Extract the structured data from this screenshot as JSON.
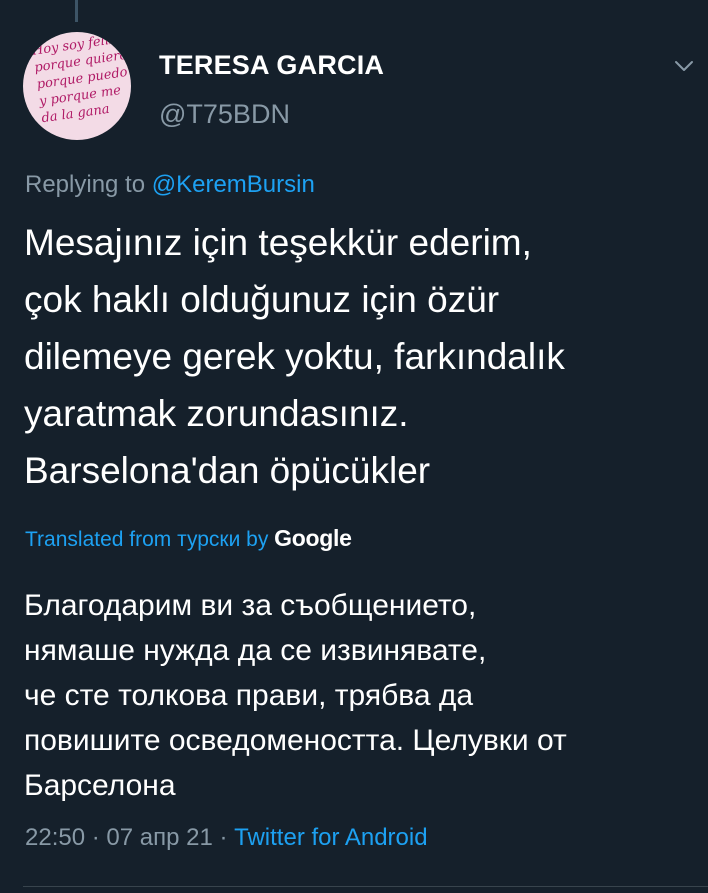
{
  "avatar": {
    "text": "Hoy soy feliz\nporque quiero,\nporque puedo\ny porque me\nda la gana"
  },
  "author": {
    "name": "TERESA GARCIA",
    "handle": "@T75BDN"
  },
  "reply": {
    "prefix": "Replying to ",
    "mention": "@KeremBursin"
  },
  "tweet": {
    "text": "Mesajınız için teşekkür ederim,\nçok haklı olduğunuz için özür\ndilemeye gerek yoktu, farkındalık\nyaratmak zorundasınız.\nBarselona'dan öpücükler"
  },
  "translation": {
    "label": "Translated from турски by ",
    "provider": "Google",
    "text": "Благодарим ви за съобщението,\nнямаше нужда да се извинявате,\nче сте толкова прави, трябва да\nповишите осведомеността. Целувки от\nБарселона"
  },
  "meta": {
    "time": "22:50",
    "separator1": " · ",
    "date": "07 апр 21",
    "separator2": " · ",
    "source": "Twitter for Android"
  },
  "icons": {
    "menu": "chevron-down-icon"
  },
  "colors": {
    "background": "#15202b",
    "accent": "#1da1f2",
    "secondary_text": "#8899a6"
  }
}
